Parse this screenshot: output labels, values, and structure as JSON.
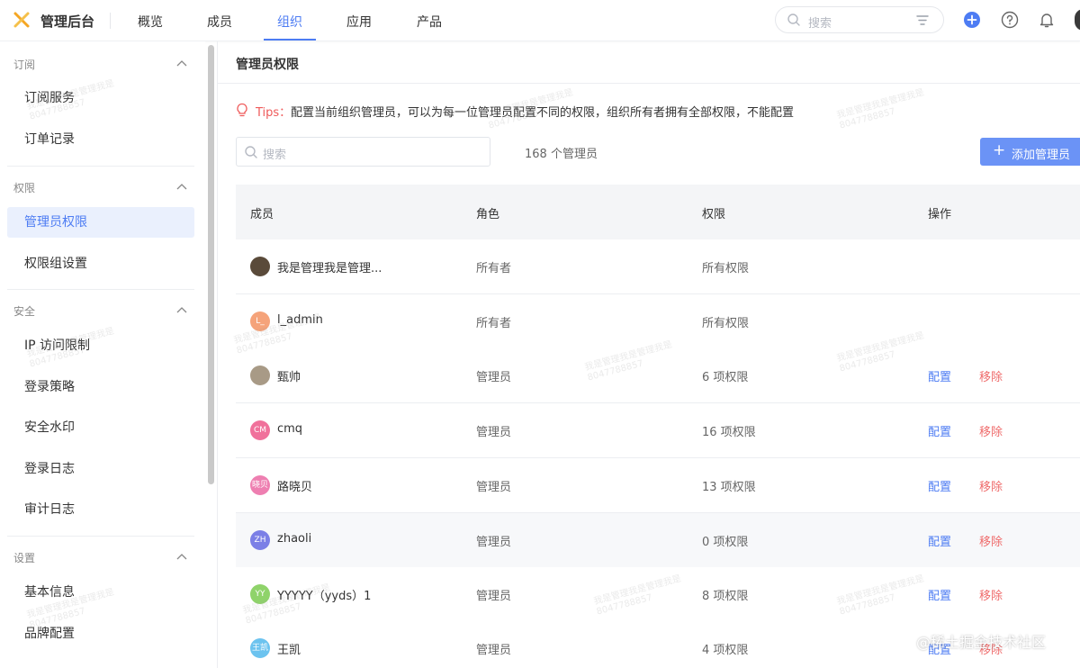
{
  "header": {
    "app_title": "管理后台",
    "tabs": [
      {
        "label": "概览"
      },
      {
        "label": "成员"
      },
      {
        "label": "组织"
      },
      {
        "label": "应用"
      },
      {
        "label": "产品"
      }
    ],
    "active_tab": "组织",
    "search_placeholder": "搜索",
    "accent_color": "#4d7cf3"
  },
  "sidebar": {
    "groups": [
      {
        "label": "订阅",
        "items": [
          {
            "label": "订阅服务"
          },
          {
            "label": "订单记录"
          }
        ]
      },
      {
        "label": "权限",
        "items": [
          {
            "label": "管理员权限"
          },
          {
            "label": "权限组设置"
          }
        ]
      },
      {
        "label": "安全",
        "items": [
          {
            "label": "IP 访问限制"
          },
          {
            "label": "登录策略"
          },
          {
            "label": "安全水印"
          },
          {
            "label": "登录日志"
          },
          {
            "label": "审计日志"
          }
        ]
      },
      {
        "label": "设置",
        "items": [
          {
            "label": "基本信息"
          },
          {
            "label": "品牌配置"
          }
        ]
      }
    ],
    "active_item": "管理员权限"
  },
  "main": {
    "page_title": "管理员权限",
    "tips_label": "Tips：",
    "tips_text": "配置当前组织管理员，可以为每一位管理员配置不同的权限，组织所有者拥有全部权限，不能配置",
    "search_placeholder": "搜索",
    "count_text": "168 个管理员",
    "add_button": "添加管理员",
    "table": {
      "columns": [
        "成员",
        "角色",
        "权限",
        "操作"
      ],
      "rows": [
        {
          "name": "我是管理我是管理...",
          "avatar": "",
          "avatar_color": "#5a4a3a",
          "role": "所有者",
          "perm": "所有权限",
          "actions": false
        },
        {
          "name": "l_admin",
          "avatar": "L_",
          "avatar_color": "#f5a37a",
          "role": "所有者",
          "perm": "所有权限",
          "actions": false
        },
        {
          "name": "甄帅",
          "avatar": "",
          "avatar_color": "#a89a86",
          "role": "管理员",
          "perm": "6 项权限",
          "actions": true
        },
        {
          "name": "cmq",
          "avatar": "CM",
          "avatar_color": "#f0719b",
          "role": "管理员",
          "perm": "16 项权限",
          "actions": true
        },
        {
          "name": "路晓贝",
          "avatar": "晓贝",
          "avatar_color": "#ee7fb1",
          "role": "管理员",
          "perm": "13 项权限",
          "actions": true
        },
        {
          "name": "zhaoli",
          "avatar": "ZH",
          "avatar_color": "#7b7fe6",
          "role": "管理员",
          "perm": "0 项权限",
          "actions": true
        },
        {
          "name": "YYYYY（yyds）1",
          "avatar": "YY",
          "avatar_color": "#8fd36a",
          "role": "管理员",
          "perm": "8 项权限",
          "actions": true
        },
        {
          "name": "王凯",
          "avatar": "王凯",
          "avatar_color": "#6cc3ef",
          "role": "管理员",
          "perm": "4 项权限",
          "actions": true
        }
      ],
      "action_config": "配置",
      "action_remove": "移除"
    }
  },
  "watermark": {
    "line1": "我是管理我是管理我是",
    "line2": "8047788857"
  },
  "credit": "@稀土掘金技术社区"
}
